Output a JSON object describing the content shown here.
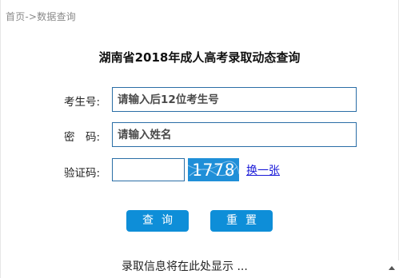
{
  "breadcrumb": {
    "text": "首页->数据查询"
  },
  "page_title": "湖南省2018年成人高考录取动态查询",
  "form": {
    "exam_number": {
      "label": "考生号:",
      "placeholder": "请输入后12位考生号"
    },
    "password": {
      "label": "密　码:",
      "placeholder": "请输入姓名"
    },
    "captcha": {
      "label": "验证码:",
      "value": "",
      "image_text": "1778",
      "refresh_label": "换一张"
    }
  },
  "buttons": {
    "query_label": "查询",
    "reset_label": "重置"
  },
  "result_placeholder": "录取信息将在此处显示 ...",
  "colors": {
    "input_border": "#2a6ea6",
    "button_bg": "#0e8ed8",
    "captcha_bg": "#1f8fd8",
    "link": "#1a1ad8"
  },
  "icons": {
    "scroll_up": "chevron-up-icon"
  }
}
